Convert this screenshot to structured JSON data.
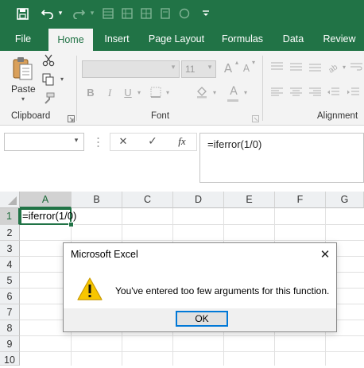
{
  "quick_access": {
    "save_icon": "save-icon",
    "undo_icon": "undo-icon",
    "redo_icon": "redo-icon",
    "customize_icon": "chevron-down-icon"
  },
  "ribbon_tabs": [
    "File",
    "Home",
    "Insert",
    "Page Layout",
    "Formulas",
    "Data",
    "Review"
  ],
  "active_tab": "Home",
  "ribbon": {
    "paste_label": "Paste",
    "clipboard_label": "Clipboard",
    "font_label": "Font",
    "font_size": "11",
    "alignment_label": "Alignment",
    "bold_label": "B",
    "italic_label": "I",
    "underline_label": "U",
    "grow_font_label": "A",
    "shrink_font_label": "A",
    "font_color_label": "A"
  },
  "formula_bar": {
    "name_box_value": "",
    "cancel_symbol": "✕",
    "enter_symbol": "✓",
    "fx_label": "fx",
    "content": "=iferror(1/0)"
  },
  "grid": {
    "columns": [
      "A",
      "B",
      "C",
      "D",
      "E",
      "F",
      "G"
    ],
    "rows": [
      "1",
      "2",
      "3",
      "4",
      "5",
      "6",
      "7",
      "8",
      "9",
      "10"
    ],
    "selected_column": "A",
    "selected_row": "1",
    "cell_a1": "=iferror(1/0)"
  },
  "dialog": {
    "title": "Microsoft Excel",
    "message": "You've entered too few arguments for this function.",
    "ok_label": "OK",
    "close_symbol": "✕",
    "icon": "warning-icon"
  },
  "colors": {
    "accent": "#217346",
    "ribbon_bg": "#f3f3f3",
    "warning": "#f7c600"
  }
}
